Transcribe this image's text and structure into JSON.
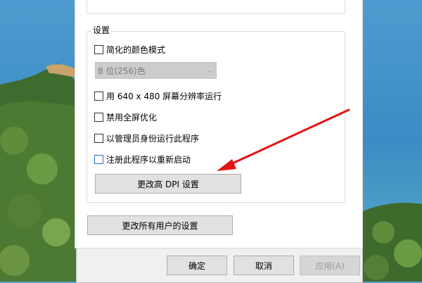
{
  "settings": {
    "group_title": "设置",
    "reduced_color_label": "简化的颜色模式",
    "color_select_value": "8 位(256)色",
    "res_640_label": "用 640 x 480 屏幕分辨率运行",
    "disable_fullscreen_label": "禁用全屏优化",
    "run_as_admin_label": "以管理员身份运行此程序",
    "register_restart_label": "注册此程序以重新启动",
    "change_dpi_button": "更改高 DPI 设置"
  },
  "all_users_button": "更改所有用户的设置",
  "footer": {
    "ok": "确定",
    "cancel": "取消",
    "apply": "应用(A)"
  },
  "colors": {
    "annotation_arrow": "#e31414",
    "checkbox_focus": "#2a6ebd"
  },
  "icons": {
    "dropdown": "chevron-down-icon"
  }
}
